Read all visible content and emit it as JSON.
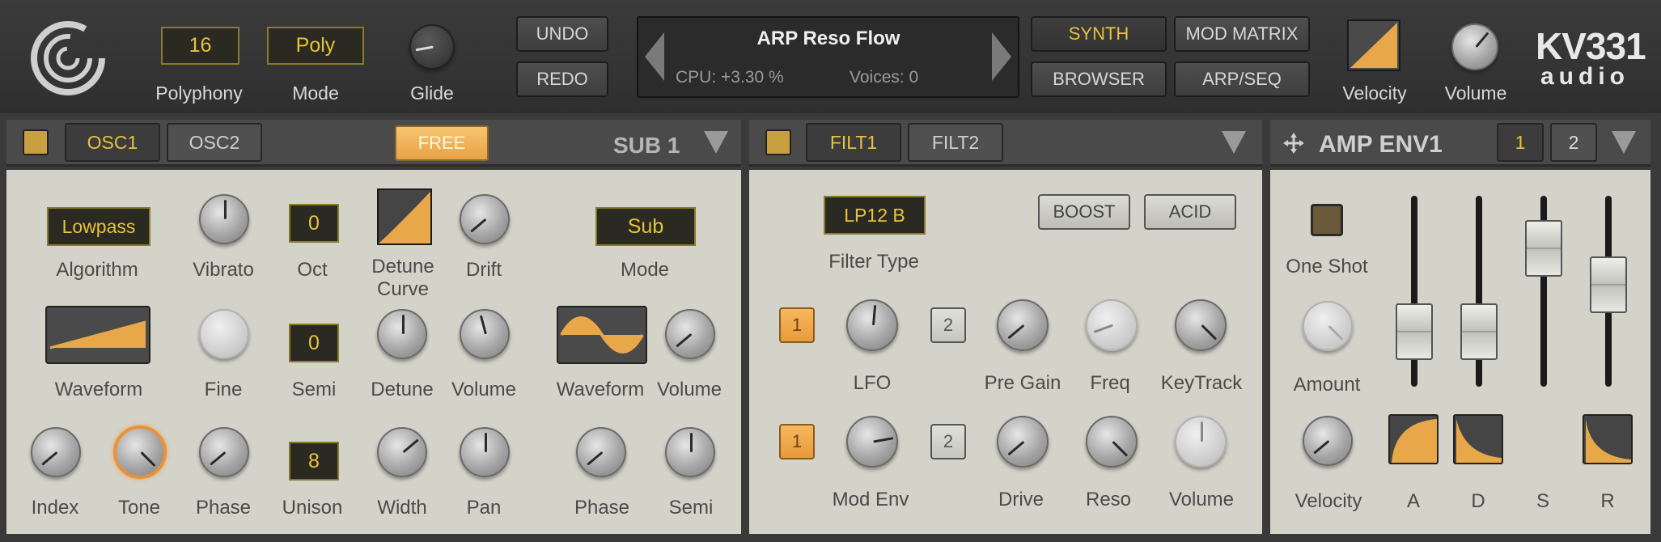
{
  "header": {
    "polyphony_value": "16",
    "polyphony_label": "Polyphony",
    "mode_value": "Poly",
    "mode_label": "Mode",
    "glide_label": "Glide",
    "undo": "UNDO",
    "redo": "REDO",
    "preset_name": "ARP Reso Flow",
    "cpu": "CPU: +3.30 %",
    "voices": "Voices: 0",
    "nav": {
      "synth": "SYNTH",
      "mod_matrix": "MOD MATRIX",
      "browser": "BROWSER",
      "arp_seq": "ARP/SEQ"
    },
    "velocity_label": "Velocity",
    "volume_label": "Volume",
    "brand_top": "KV331",
    "brand_bottom": "audio"
  },
  "osc": {
    "tabs": [
      "OSC1",
      "OSC2"
    ],
    "free": "FREE",
    "sub_title": "SUB 1",
    "algorithm_value": "Lowpass",
    "labels": {
      "algorithm": "Algorithm",
      "vibrato": "Vibrato",
      "oct": "Oct",
      "detune_curve_1": "Detune",
      "detune_curve_2": "Curve",
      "drift": "Drift",
      "sub_mode": "Mode",
      "waveform": "Waveform",
      "fine": "Fine",
      "semi": "Semi",
      "detune": "Detune",
      "volume": "Volume",
      "sub_waveform": "Waveform",
      "sub_volume": "Volume",
      "index": "Index",
      "tone": "Tone",
      "phase": "Phase",
      "unison": "Unison",
      "width": "Width",
      "pan": "Pan",
      "sub_phase": "Phase",
      "sub_semi": "Semi"
    },
    "oct_value": "0",
    "semi_value": "0",
    "unison_value": "8",
    "sub_mode_value": "Sub"
  },
  "filter": {
    "tabs": [
      "FILT1",
      "FILT2"
    ],
    "type_value": "LP12 B",
    "type_label": "Filter Type",
    "boost": "BOOST",
    "acid": "ACID",
    "lfo_btn_1": "1",
    "lfo_btn_2": "2",
    "env_btn_1": "1",
    "env_btn_2": "2",
    "labels": {
      "lfo": "LFO",
      "pre_gain": "Pre Gain",
      "freq": "Freq",
      "keytrack": "KeyTrack",
      "mod_env": "Mod Env",
      "drive": "Drive",
      "reso": "Reso",
      "volume": "Volume"
    }
  },
  "amp": {
    "title": "AMP ENV1",
    "btn_1": "1",
    "btn_2": "2",
    "labels": {
      "one_shot": "One Shot",
      "amount": "Amount",
      "velocity": "Velocity",
      "a": "A",
      "d": "D",
      "s": "S",
      "r": "R"
    },
    "sliders": {
      "a": 0.2,
      "d": 0.2,
      "s": 0.82,
      "r": 0.55
    }
  },
  "colors": {
    "accent": "#e8c23a",
    "orange": "#e8a040",
    "panel": "#d4d3c9",
    "dark": "#3a3a3a"
  }
}
